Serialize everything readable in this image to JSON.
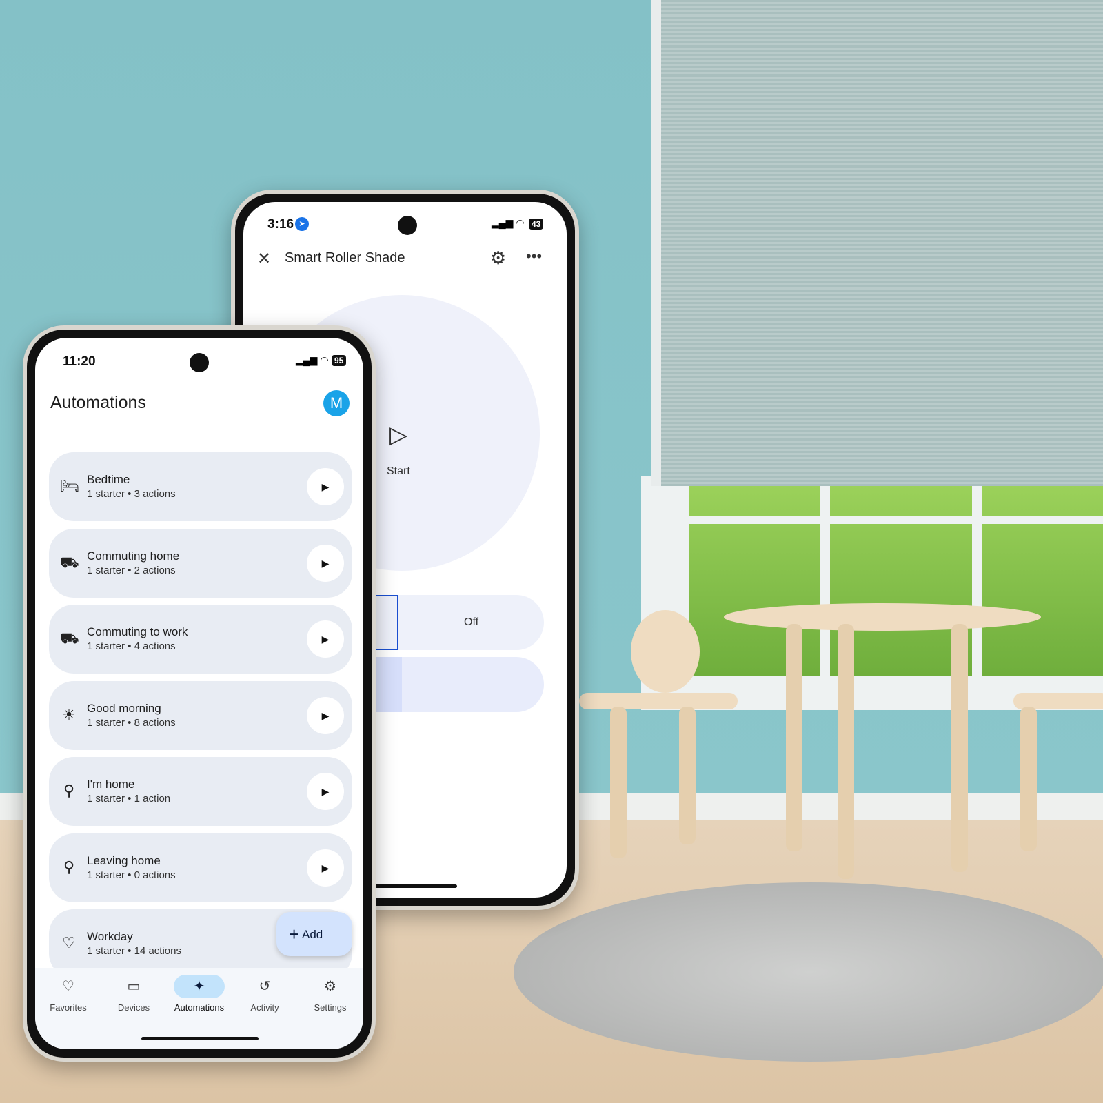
{
  "back_phone": {
    "status": {
      "time": "3:16",
      "battery": "43"
    },
    "title": "Smart Roller Shade",
    "start_label": "Start",
    "mode_off_label": "Off"
  },
  "front_phone": {
    "status": {
      "time": "11:20",
      "battery": "95"
    },
    "title": "Automations",
    "avatar_letter": "M",
    "automations": [
      {
        "name": "Bedtime",
        "detail": "1 starter • 3 actions",
        "icon": "bed-icon"
      },
      {
        "name": "Commuting home",
        "detail": "1 starter • 2 actions",
        "icon": "commute-icon"
      },
      {
        "name": "Commuting to work",
        "detail": "1 starter • 4 actions",
        "icon": "commute-icon"
      },
      {
        "name": "Good morning",
        "detail": "1 starter • 8 actions",
        "icon": "sun-icon"
      },
      {
        "name": "I'm home",
        "detail": "1 starter • 1 action",
        "icon": "location-pin-icon"
      },
      {
        "name": "Leaving home",
        "detail": "1 starter • 0 actions",
        "icon": "location-pin-icon"
      },
      {
        "name": "Workday",
        "detail": "1 starter • 14 actions",
        "icon": "person-heart-icon"
      }
    ],
    "add_label": "Add",
    "nav": [
      {
        "label": "Favorites",
        "icon": "heart-icon"
      },
      {
        "label": "Devices",
        "icon": "devices-icon"
      },
      {
        "label": "Automations",
        "icon": "sparkle-icon",
        "active": true
      },
      {
        "label": "Activity",
        "icon": "history-icon"
      },
      {
        "label": "Settings",
        "icon": "gear-icon"
      }
    ],
    "accent": "#c2e3fb"
  }
}
